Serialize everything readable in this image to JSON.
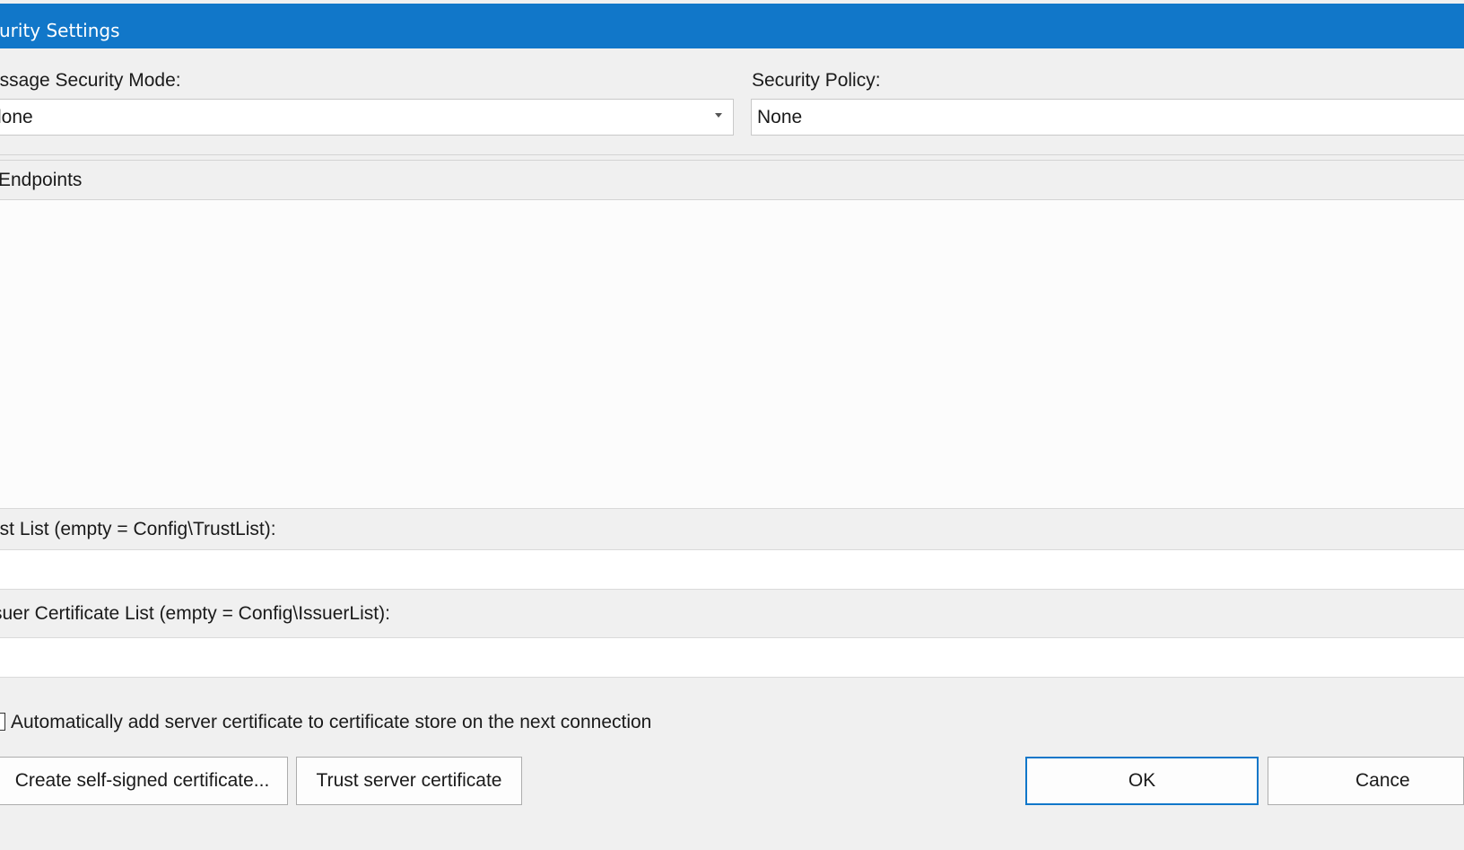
{
  "window": {
    "title": "curity Settings"
  },
  "security_mode": {
    "label": "essage Security Mode:",
    "value": "lone"
  },
  "security_policy": {
    "label": "Security Policy:",
    "value": "None"
  },
  "endpoints": {
    "header": "Endpoints",
    "items": []
  },
  "trust_list": {
    "label": "ust List (empty = Config\\TrustList):",
    "value": ""
  },
  "issuer_list": {
    "label": "suer Certificate List (empty = Config\\IssuerList):",
    "value": ""
  },
  "auto_add": {
    "label": "Automatically add server certificate to certificate store on the next connection",
    "checked": false
  },
  "buttons": {
    "create_cert": "Create self-signed certificate...",
    "trust_cert": "Trust server certificate",
    "ok": "OK",
    "cancel": "Cance"
  },
  "colors": {
    "titlebar": "#1177c9",
    "background": "#f0f0f0",
    "accent_border": "#1177c9"
  },
  "icons": {
    "dropdown": "chevron-down-icon"
  }
}
